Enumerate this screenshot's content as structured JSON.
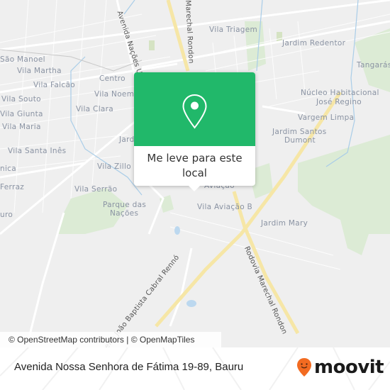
{
  "map": {
    "labels": [
      {
        "text": "São Manoel"
      },
      {
        "text": "Vila Martha"
      },
      {
        "text": "Vila Falcão"
      },
      {
        "text": "Vila Souto"
      },
      {
        "text": "Vila Giunta"
      },
      {
        "text": "Vila Maria"
      },
      {
        "text": "Vila Santa Inês"
      },
      {
        "text": "nica"
      },
      {
        "text": "Ferraz"
      },
      {
        "text": "uro"
      },
      {
        "text": "Centro"
      },
      {
        "text": "Vila Noemi"
      },
      {
        "text": "Vila Clara"
      },
      {
        "text": "Jard"
      },
      {
        "text": "Vila Zillo"
      },
      {
        "text": "Vila Serrão"
      },
      {
        "text": "Parque das"
      },
      {
        "text": "Nações"
      },
      {
        "text": "Vila Triagem"
      },
      {
        "text": "Jardim Redentor"
      },
      {
        "text": "Tangarás"
      },
      {
        "text": "Núcleo Habitacional"
      },
      {
        "text": "José Regino"
      },
      {
        "text": "Vargem Limpa"
      },
      {
        "text": "Jardim Santos"
      },
      {
        "text": "Dumont"
      },
      {
        "text": "Aviação"
      },
      {
        "text": "Vila Aviação B"
      },
      {
        "text": "Jardim Mary"
      }
    ],
    "road_labels": [
      {
        "text": "Avenida Nações Unidas"
      },
      {
        "text": "Marechal Rondon"
      },
      {
        "text": "Rodovia Marechal Rondon"
      },
      {
        "text": "Conselheiro João Baptista Cabral Rennó"
      }
    ],
    "attribution": "© OpenStreetMap contributors | © OpenMapTiles"
  },
  "popup": {
    "icon": "map-pin-icon",
    "label": "Me leve para este local",
    "color": "#21b86a"
  },
  "footer": {
    "address": "Avenida Nossa Senhora de Fátima 19-89, Bauru",
    "brand": "moovit",
    "brand_color": "#f26b21"
  }
}
